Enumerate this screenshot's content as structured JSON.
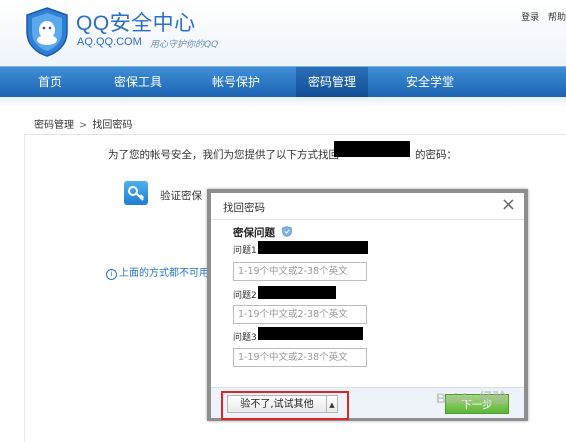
{
  "header": {
    "title": "QQ安全中心",
    "domain": "AQ.QQ.COM",
    "slogan": "用心守护你的QQ",
    "links": [
      "登录",
      "帮助"
    ]
  },
  "nav": {
    "items": [
      {
        "label": "首页"
      },
      {
        "label": "密保工具"
      },
      {
        "label": "帐号保护"
      },
      {
        "label": "密码管理",
        "active": true
      },
      {
        "label": "安全学堂"
      }
    ]
  },
  "breadcrumb": {
    "parent": "密码管理",
    "current": "找回密码"
  },
  "main": {
    "intro_prefix": "为了您的帐号安全，我们为您提供了以下方式找回",
    "intro_suffix": "的密码：",
    "method_label": "验证密保",
    "hint": "上面的方式都不可用"
  },
  "dialog": {
    "title": "找回密码",
    "close": "×",
    "section": "密保问题",
    "questions": [
      {
        "label": "问题1",
        "placeholder": "1-19个中文或2-38个英文"
      },
      {
        "label": "问题2",
        "placeholder": "1-19个中文或2-38个英文"
      },
      {
        "label": "问题3",
        "placeholder": "1-19个中文或2-38个英文"
      }
    ],
    "try_other": "验不了,试试其他",
    "try_arrow": "▲",
    "next": "下一步"
  },
  "watermark": "Baidu 经验",
  "colors": {
    "nav_blue": "#1c63b2",
    "brand_blue": "#2c6fc4",
    "highlight_red": "#e0262b",
    "next_green": "#5fb33a"
  }
}
